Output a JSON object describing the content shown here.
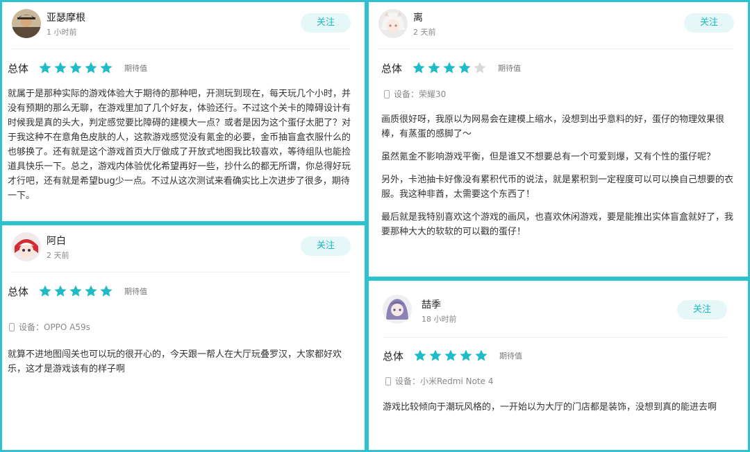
{
  "colors": {
    "accent": "#2cc1cf",
    "star_filled": "#1fbcc8",
    "star_empty": "#d9d9d9",
    "follow_bg": "#e6f7f7"
  },
  "reviews": [
    {
      "username": "亚瑟摩根",
      "time": "1 小时前",
      "follow_label": "关注",
      "rating_label": "总体",
      "stars": 5,
      "expect_label": "期待值",
      "paragraphs": [
        "就属于是那种实际的游戏体验大于期待的那种吧，开测玩到现在，每天玩几个小时，并没有预期的那么无聊，在游戏里加了几个好友，体验还行。不过这个关卡的障碍设计有时候我是真的头大，判定感觉要比障碍的建模大一点？或者是因为这个蛋仔太肥了？对于我这种不在意角色皮肤的人，这款游戏感觉没有氪金的必要，金币抽盲盒衣服什么的也够换了。还有就是这个游戏首页大厅做成了开放式地图我比较喜欢，等待组队也能捡道具快乐一下。总之，游戏内体验优化希望再好一些，抄什么的都无所谓，你总得好玩才行吧，还有就是希望bug少一点。不过从这次测试来看确实比上次进步了很多，期待一下。"
      ]
    },
    {
      "username": "阿白",
      "time": "2 天前",
      "follow_label": "关注",
      "rating_label": "总体",
      "stars": 5,
      "expect_label": "期待值",
      "device": "设备：OPPO A59s",
      "paragraphs": [
        "就算不进地图闯关也可以玩的很开心的，今天跟一帮人在大厅玩叠罗汉，大家都好欢乐，这才是游戏该有的样子啊"
      ]
    },
    {
      "username": "离",
      "time": "2 天前",
      "follow_label": "关注",
      "rating_label": "总体",
      "stars": 4,
      "expect_label": "期待值",
      "device": "设备：荣耀30",
      "paragraphs": [
        "画质很好呀，我原以为网易会在建模上缩水，没想到出乎意料的好，蛋仔的物理效果很棒，有蒸蛋的感脚了～",
        "虽然氪金不影响游戏平衡，但是谁又不想要总有一个可爱到爆，又有个性的蛋仔呢？",
        "另外，卡池抽卡好像没有累积代币的说法，就是累积到一定程度可以可以换自己想要的衣服。我这种非酋，太需要这个东西了！",
        "最后就是我特别喜欢这个游戏的画风，也喜欢休闲游戏，要是能推出实体盲盒就好了，我要那种大大的软软的可以戳的蛋仔！"
      ]
    },
    {
      "username": "喆季",
      "time": "18 小时前",
      "follow_label": "关注",
      "rating_label": "总体",
      "stars": 5,
      "expect_label": "期待值",
      "device": "设备：小米Redmi Note 4",
      "paragraphs": [
        "游戏比较倾向于潮玩风格的，一开始以为大厅的门店都是装饰，没想到真的能进去啊"
      ]
    }
  ]
}
